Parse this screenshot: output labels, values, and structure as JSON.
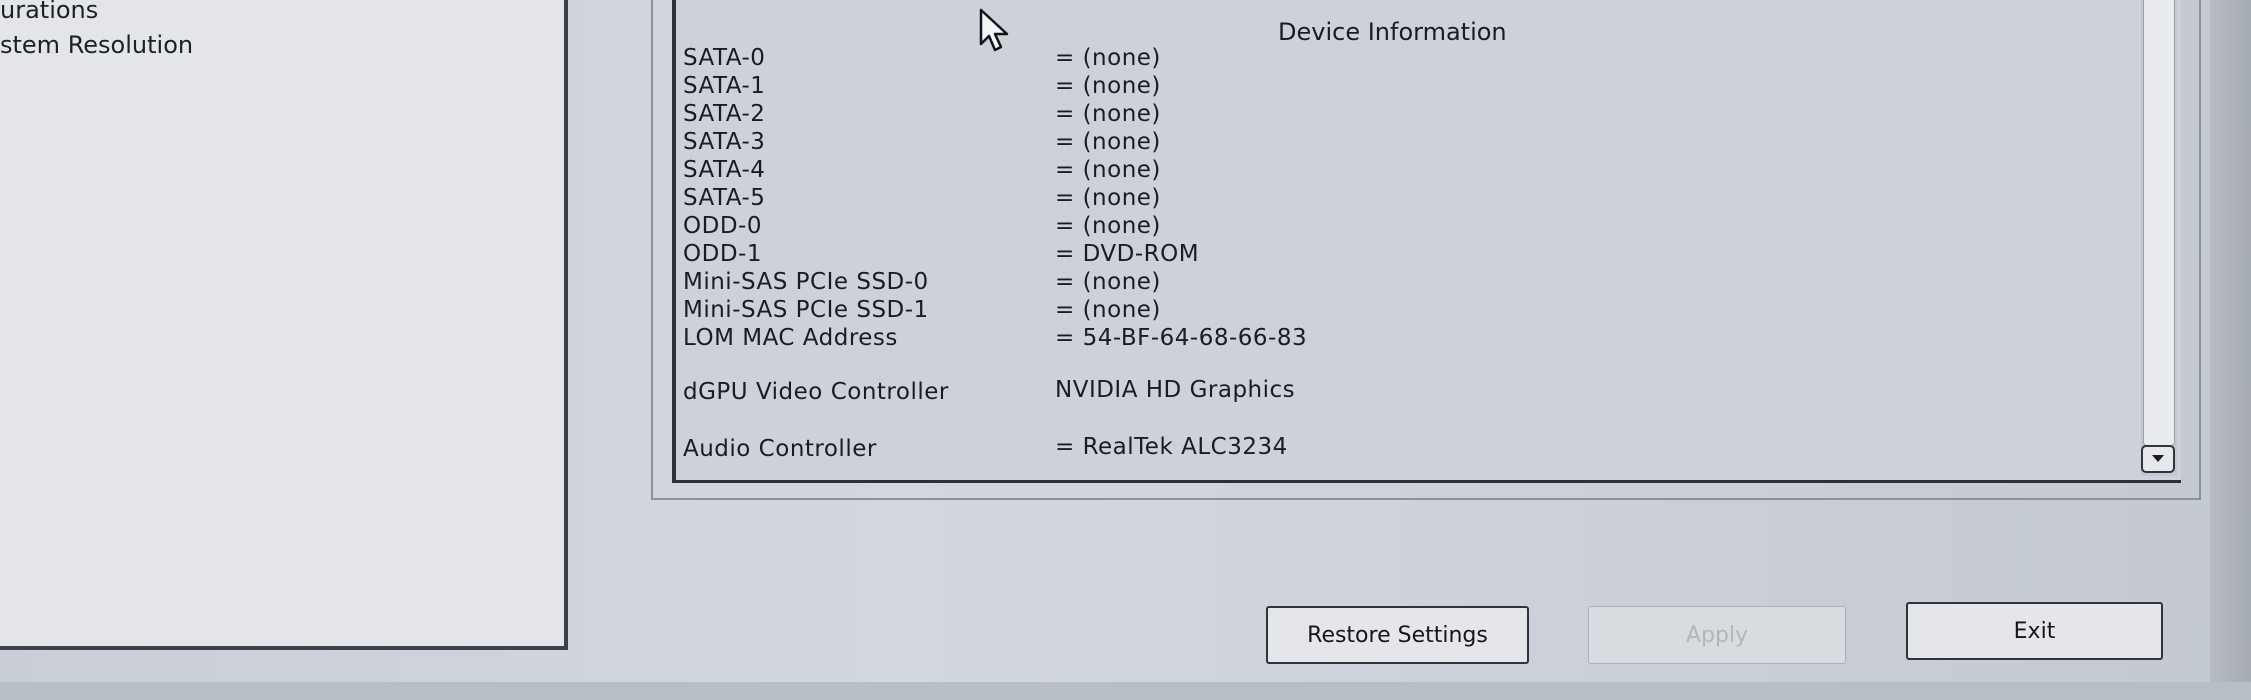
{
  "nav": {
    "items": [
      {
        "label": "urations"
      },
      {
        "label": "stem Resolution"
      }
    ]
  },
  "info": {
    "heading": "Device Information",
    "rows": [
      {
        "label": "SATA-0",
        "value": "= (none)"
      },
      {
        "label": "SATA-1",
        "value": "= (none)"
      },
      {
        "label": "SATA-2",
        "value": "= (none)"
      },
      {
        "label": "SATA-3",
        "value": "= (none)"
      },
      {
        "label": "SATA-4",
        "value": "= (none)"
      },
      {
        "label": "SATA-5",
        "value": "= (none)"
      },
      {
        "label": "ODD-0",
        "value": "= (none)"
      },
      {
        "label": "ODD-1",
        "value": "= DVD-ROM"
      },
      {
        "label": "Mini-SAS PCIe SSD-0",
        "value": "= (none)"
      },
      {
        "label": "Mini-SAS PCIe SSD-1",
        "value": "= (none)"
      },
      {
        "label": "LOM MAC Address",
        "value": "= 54-BF-64-68-66-83"
      },
      {
        "label": "dGPU Video Controller",
        "value": "NVIDIA HD Graphics"
      },
      {
        "label": "Audio Controller",
        "value": "= RealTek ALC3234"
      }
    ]
  },
  "buttons": {
    "restore": "Restore Settings",
    "apply": "Apply",
    "exit": "Exit"
  },
  "icons": {
    "cursor": "mouse-pointer-icon",
    "scroll_down": "chevron-down-icon"
  }
}
